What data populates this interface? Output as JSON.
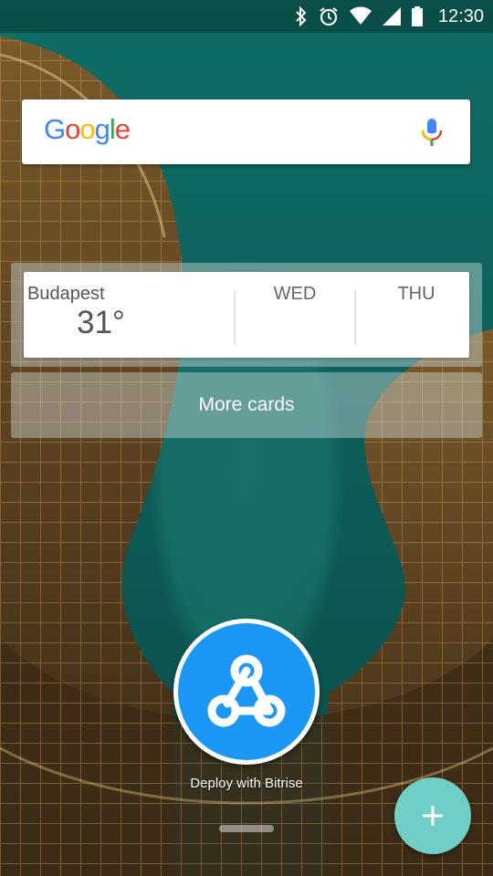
{
  "status_bar": {
    "time": "12:30",
    "icons": [
      "bluetooth-icon",
      "alarm-icon",
      "wifi-icon",
      "signal-icon",
      "battery-icon"
    ]
  },
  "search_widget": {
    "logo_letters": [
      {
        "char": "G",
        "color": "#4285F4"
      },
      {
        "char": "o",
        "color": "#EA4335"
      },
      {
        "char": "o",
        "color": "#FBBC05"
      },
      {
        "char": "g",
        "color": "#4285F4"
      },
      {
        "char": "l",
        "color": "#34A853"
      },
      {
        "char": "e",
        "color": "#EA4335"
      }
    ],
    "mic_icon": "microphone-icon"
  },
  "weather_card": {
    "city": "Budapest",
    "temperature": "31°",
    "days": [
      "WED",
      "THU"
    ]
  },
  "more_cards": {
    "label": "More cards"
  },
  "app_shortcut": {
    "label": "Deploy with Bitrise",
    "icon": "webhook-icon",
    "color": "#1B98F5"
  },
  "fab": {
    "icon": "plus-icon",
    "color": "#6FCFC6"
  }
}
